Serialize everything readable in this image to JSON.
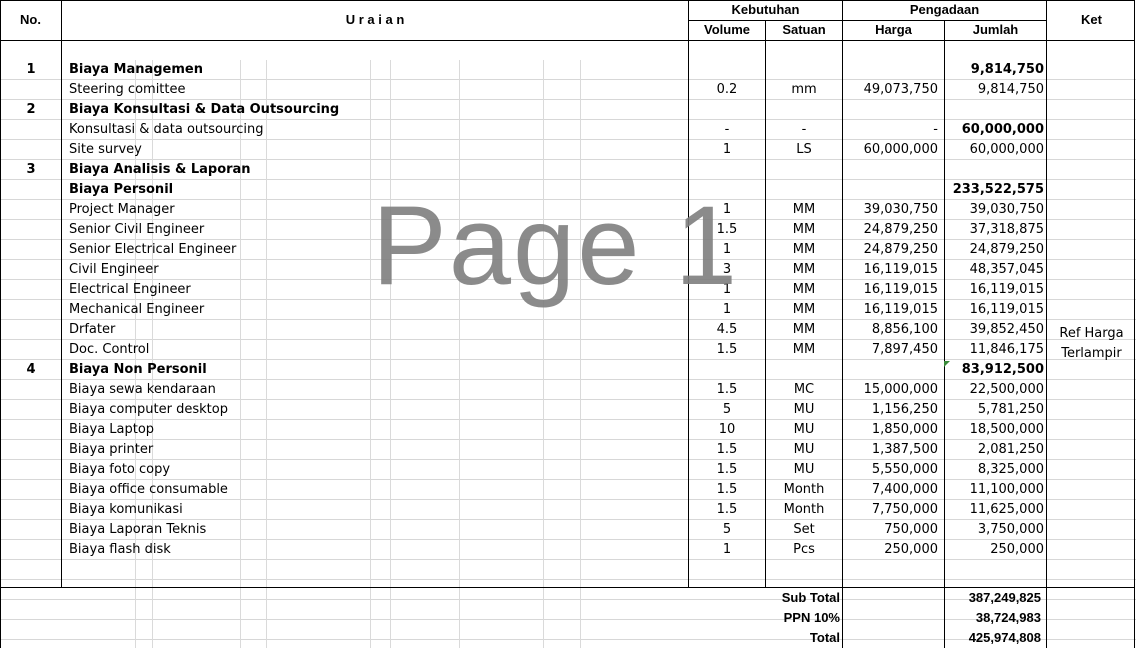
{
  "header": {
    "no": "No.",
    "uraian": "U r a i a n",
    "kebutuhan": "Kebutuhan",
    "pengadaan": "Pengadaan",
    "ket": "Ket",
    "volume": "Volume",
    "satuan": "Satuan",
    "harga": "Harga",
    "jumlah": "Jumlah"
  },
  "rows": [
    {
      "no": "1",
      "uraian": "Biaya Managemen",
      "volume": "",
      "satuan": "",
      "harga": "",
      "jumlah": "9,814,750",
      "bold": true,
      "jumlah_bold": true
    },
    {
      "no": "",
      "uraian": "Steering comittee",
      "volume": "0.2",
      "satuan": "mm",
      "harga": "49,073,750",
      "jumlah": "9,814,750",
      "bold": false,
      "jumlah_bold": false
    },
    {
      "no": "2",
      "uraian": "Biaya Konsultasi & Data Outsourcing",
      "volume": "",
      "satuan": "",
      "harga": "",
      "jumlah": "",
      "bold": true,
      "jumlah_bold": false
    },
    {
      "no": "",
      "uraian": "Konsultasi & data outsourcing",
      "volume": "-",
      "satuan": "-",
      "harga": "-",
      "jumlah": "60,000,000",
      "bold": false,
      "jumlah_bold": true
    },
    {
      "no": "",
      "uraian": "Site survey",
      "volume": "1",
      "satuan": "LS",
      "harga": "60,000,000",
      "jumlah": "60,000,000",
      "bold": false,
      "jumlah_bold": false
    },
    {
      "no": "3",
      "uraian": "Biaya Analisis & Laporan",
      "volume": "",
      "satuan": "",
      "harga": "",
      "jumlah": "",
      "bold": true,
      "jumlah_bold": false
    },
    {
      "no": "",
      "uraian": "Biaya Personil",
      "volume": "",
      "satuan": "",
      "harga": "",
      "jumlah": "233,522,575",
      "bold": true,
      "jumlah_bold": true
    },
    {
      "no": "",
      "uraian": "Project Manager",
      "volume": "1",
      "satuan": "MM",
      "harga": "39,030,750",
      "jumlah": "39,030,750",
      "bold": false,
      "jumlah_bold": false
    },
    {
      "no": "",
      "uraian": "Senior Civil Engineer",
      "volume": "1.5",
      "satuan": "MM",
      "harga": "24,879,250",
      "jumlah": "37,318,875",
      "bold": false,
      "jumlah_bold": false
    },
    {
      "no": "",
      "uraian": "Senior Electrical Engineer",
      "volume": "1",
      "satuan": "MM",
      "harga": "24,879,250",
      "jumlah": "24,879,250",
      "bold": false,
      "jumlah_bold": false
    },
    {
      "no": "",
      "uraian": "Civil Engineer",
      "volume": "3",
      "satuan": "MM",
      "harga": "16,119,015",
      "jumlah": "48,357,045",
      "bold": false,
      "jumlah_bold": false
    },
    {
      "no": "",
      "uraian": "Electrical Engineer",
      "volume": "1",
      "satuan": "MM",
      "harga": "16,119,015",
      "jumlah": "16,119,015",
      "bold": false,
      "jumlah_bold": false
    },
    {
      "no": "",
      "uraian": "Mechanical Engineer",
      "volume": "1",
      "satuan": "MM",
      "harga": "16,119,015",
      "jumlah": "16,119,015",
      "bold": false,
      "jumlah_bold": false
    },
    {
      "no": "",
      "uraian": "Drfater",
      "volume": "4.5",
      "satuan": "MM",
      "harga": "8,856,100",
      "jumlah": "39,852,450",
      "bold": false,
      "jumlah_bold": false
    },
    {
      "no": "",
      "uraian": "Doc. Control",
      "volume": "1.5",
      "satuan": "MM",
      "harga": "7,897,450",
      "jumlah": "11,846,175",
      "bold": false,
      "jumlah_bold": false
    },
    {
      "no": "4",
      "uraian": "Biaya Non Personil",
      "volume": "",
      "satuan": "",
      "harga": "",
      "jumlah": "83,912,500",
      "bold": true,
      "jumlah_bold": true
    },
    {
      "no": "",
      "uraian": "Biaya sewa kendaraan",
      "volume": "1.5",
      "satuan": "MC",
      "harga": "15,000,000",
      "jumlah": "22,500,000",
      "bold": false,
      "jumlah_bold": false
    },
    {
      "no": "",
      "uraian": "Biaya computer desktop",
      "volume": "5",
      "satuan": "MU",
      "harga": "1,156,250",
      "jumlah": "5,781,250",
      "bold": false,
      "jumlah_bold": false
    },
    {
      "no": "",
      "uraian": "Biaya Laptop",
      "volume": "10",
      "satuan": "MU",
      "harga": "1,850,000",
      "jumlah": "18,500,000",
      "bold": false,
      "jumlah_bold": false
    },
    {
      "no": "",
      "uraian": "Biaya printer",
      "volume": "1.5",
      "satuan": "MU",
      "harga": "1,387,500",
      "jumlah": "2,081,250",
      "bold": false,
      "jumlah_bold": false
    },
    {
      "no": "",
      "uraian": "Biaya foto copy",
      "volume": "1.5",
      "satuan": "MU",
      "harga": "5,550,000",
      "jumlah": "8,325,000",
      "bold": false,
      "jumlah_bold": false
    },
    {
      "no": "",
      "uraian": "Biaya office consumable",
      "volume": "1.5",
      "satuan": "Month",
      "harga": "7,400,000",
      "jumlah": "11,100,000",
      "bold": false,
      "jumlah_bold": false
    },
    {
      "no": "",
      "uraian": "Biaya komunikasi",
      "volume": "1.5",
      "satuan": "Month",
      "harga": "7,750,000",
      "jumlah": "11,625,000",
      "bold": false,
      "jumlah_bold": false
    },
    {
      "no": "",
      "uraian": "Biaya Laporan Teknis",
      "volume": "5",
      "satuan": "Set",
      "harga": "750,000",
      "jumlah": "3,750,000",
      "bold": false,
      "jumlah_bold": false
    },
    {
      "no": "",
      "uraian": "Biaya flash disk",
      "volume": "1",
      "satuan": "Pcs",
      "harga": "250,000",
      "jumlah": "250,000",
      "bold": false,
      "jumlah_bold": false
    }
  ],
  "ket_note": {
    "line1": "Ref Harga",
    "line2": "Terlampir"
  },
  "totals": [
    {
      "label": "Sub Total",
      "value": "387,249,825"
    },
    {
      "label": "PPN 10%",
      "value": "38,724,983"
    },
    {
      "label": "Total",
      "value": "425,974,808"
    }
  ],
  "watermark": "Page 1",
  "colors": {
    "grid": "#d7d7d7",
    "border": "#000000",
    "watermark": "#7f7f7f",
    "comment_marker": "#3a8a3a"
  }
}
